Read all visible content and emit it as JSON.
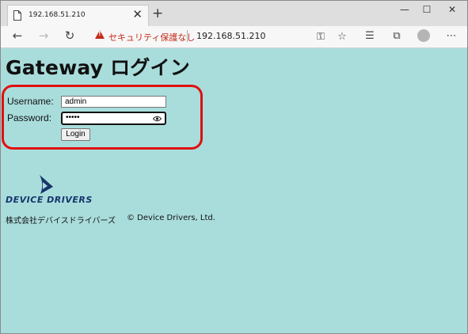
{
  "browser": {
    "tab_title": "192.168.51.210",
    "tab_close": "✕",
    "new_tab": "+",
    "window_controls": {
      "minimize": "—",
      "maximize": "☐",
      "close": "✕"
    },
    "nav": {
      "back": "←",
      "forward": "→",
      "refresh": "↻"
    },
    "security_warning": "セキュリティ保護なし",
    "url": "192.168.51.210",
    "icons": {
      "key": "⚿",
      "favorite": "☆",
      "favorites_bar": "☰",
      "collections": "⧉",
      "menu": "⋯"
    }
  },
  "page": {
    "title": "Gateway ログイン",
    "username_label": "Username:",
    "username_value": "admin",
    "password_label": "Password:",
    "password_value": "•••••",
    "login_button": "Login",
    "logo_text": "DEVICE DRIVERS",
    "company_name": "株式会社デバイスドライバーズ",
    "copyright": "© Device Drivers, Ltd."
  },
  "colors": {
    "page_background": "#a9dddc",
    "highlight_border": "#e01010",
    "logo_blue": "#17356b",
    "warning_red": "#c42b1c"
  }
}
